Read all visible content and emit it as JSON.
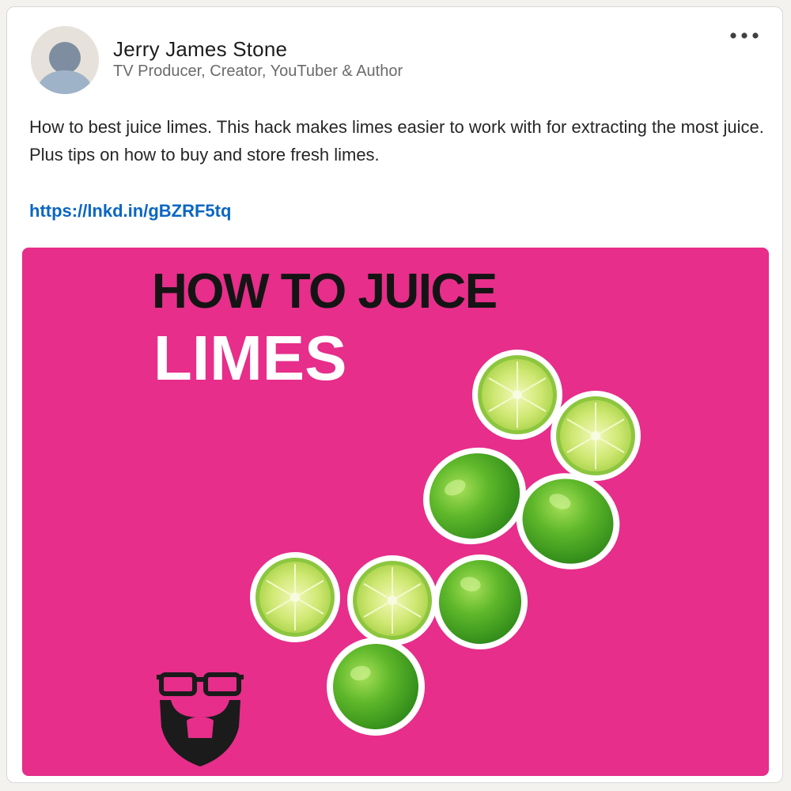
{
  "post": {
    "author": {
      "name": "Jerry James Stone",
      "headline": "TV Producer, Creator, YouTuber & Author"
    },
    "menu_icon": "more-horizontal-icon",
    "text": "How to best juice limes. This hack makes limes easier to work with for extracting the most juice. Plus tips on how to buy and store fresh limes.",
    "link": "https://lnkd.in/gBZRF5tq",
    "image": {
      "title_line1": "HOW TO JUICE",
      "title_line2": "LIMES",
      "background_color": "#e62e8a",
      "logo_icon": "bearded-man-glasses-logo"
    }
  },
  "colors": {
    "link": "#0a66c2",
    "background": "#e62e8a",
    "lime": "#6cbf2a"
  }
}
